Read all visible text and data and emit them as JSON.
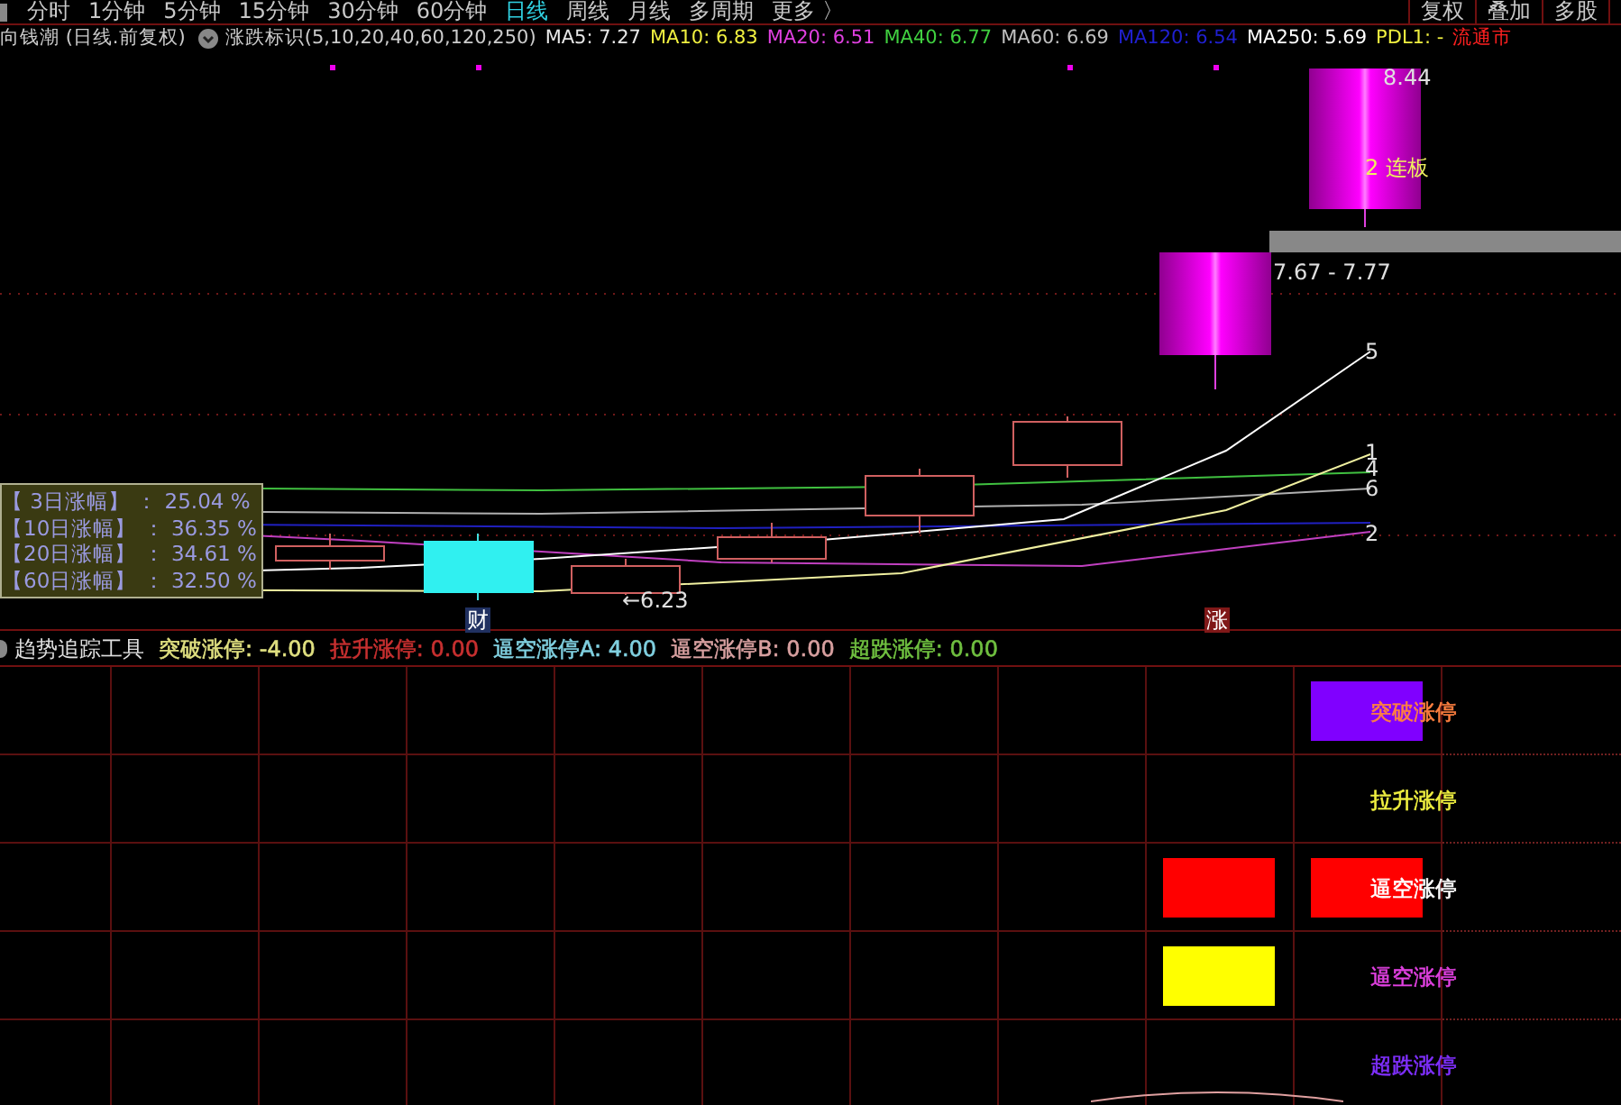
{
  "period_tabs": [
    {
      "label": "分时",
      "selected": false
    },
    {
      "label": "1分钟",
      "selected": false
    },
    {
      "label": "5分钟",
      "selected": false
    },
    {
      "label": "15分钟",
      "selected": false
    },
    {
      "label": "30分钟",
      "selected": false
    },
    {
      "label": "60分钟",
      "selected": false
    },
    {
      "label": "日线",
      "selected": true
    },
    {
      "label": "周线",
      "selected": false
    },
    {
      "label": "月线",
      "selected": false
    },
    {
      "label": "多周期",
      "selected": false
    },
    {
      "label": "更多 〉",
      "selected": false
    }
  ],
  "toolbar_buttons": [
    "复权",
    "叠加",
    "多股"
  ],
  "main_legend": {
    "title": "向钱潮 (日线.前复权)",
    "indicator": "涨跌标识(5,10,20,40,60,120,250)",
    "items": [
      {
        "text": "MA5: 7.27",
        "color": "#e8e8e8"
      },
      {
        "text": "MA10: 6.83",
        "color": "#f0f040"
      },
      {
        "text": "MA20: 6.51",
        "color": "#e040e0"
      },
      {
        "text": "MA40: 6.77",
        "color": "#40d040"
      },
      {
        "text": "MA60: 6.69",
        "color": "#c0c0c0"
      },
      {
        "text": "MA120: 6.54",
        "color": "#2020d0"
      },
      {
        "text": "MA250: 5.69",
        "color": "#ffffff"
      },
      {
        "text": "PDL1: -",
        "color": "#f0f040"
      },
      {
        "text": "流通市",
        "color": "#ff2020"
      }
    ]
  },
  "chart_labels": {
    "high_price": "8.44",
    "streak": "2 连板",
    "price_range": "7.67 - 7.77",
    "low_price": "←6.23",
    "line_labels": [
      "5",
      "1",
      "4",
      "6",
      "2"
    ],
    "finance_marker": "财",
    "limit_up_marker": "涨"
  },
  "gain_box": [
    "【  3日涨幅】 ：  25.04 %",
    "【10日涨幅】 ：  36.35 %",
    "【20日涨幅】 ：  34.61 %",
    "【60日涨幅】 ：  32.50 %"
  ],
  "indicator_legend": {
    "title": "趋势追踪工具",
    "items": [
      {
        "text": "突破涨停: -4.00",
        "color": "#e0e080"
      },
      {
        "text": "拉升涨停: 0.00",
        "color": "#c83030"
      },
      {
        "text": "逼空涨停A: 4.00",
        "color": "#80d0e0"
      },
      {
        "text": "逼空涨停B: 0.00",
        "color": "#d8a0a0"
      },
      {
        "text": "超跌涨停: 0.00",
        "color": "#70c040"
      }
    ]
  },
  "signal_rows": [
    {
      "label": "突破涨停",
      "color": "#ff8040",
      "cells": [
        {
          "filled": false
        },
        {
          "filled": false
        },
        {
          "filled": false
        },
        {
          "filled": false
        },
        {
          "filled": false
        },
        {
          "filled": false
        },
        {
          "filled": false
        },
        {
          "filled": false
        },
        {
          "filled": false
        },
        {
          "filled": true,
          "color": "#8000ff"
        }
      ]
    },
    {
      "label": "拉升涨停",
      "color": "#f0f040",
      "cells": [
        {
          "filled": false
        },
        {
          "filled": false
        },
        {
          "filled": false
        },
        {
          "filled": false
        },
        {
          "filled": false
        },
        {
          "filled": false
        },
        {
          "filled": false
        },
        {
          "filled": false
        },
        {
          "filled": false
        },
        {
          "filled": false
        }
      ]
    },
    {
      "label": "逼空涨停",
      "color": "#ffffff",
      "cells": [
        {
          "filled": false
        },
        {
          "filled": false
        },
        {
          "filled": false
        },
        {
          "filled": false
        },
        {
          "filled": false
        },
        {
          "filled": false
        },
        {
          "filled": false
        },
        {
          "filled": false
        },
        {
          "filled": true,
          "color": "#ff0000"
        },
        {
          "filled": true,
          "color": "#ff0000"
        }
      ]
    },
    {
      "label": "逼空涨停",
      "color": "#e040e0",
      "cells": [
        {
          "filled": false
        },
        {
          "filled": false
        },
        {
          "filled": false
        },
        {
          "filled": false
        },
        {
          "filled": false
        },
        {
          "filled": false
        },
        {
          "filled": false
        },
        {
          "filled": false
        },
        {
          "filled": true,
          "color": "#ffff00"
        },
        {
          "filled": false
        }
      ]
    },
    {
      "label": "超跌涨停",
      "color": "#8030ff",
      "cells": [
        {
          "filled": false
        },
        {
          "filled": false
        },
        {
          "filled": false
        },
        {
          "filled": false
        },
        {
          "filled": false
        },
        {
          "filled": false
        },
        {
          "filled": false
        },
        {
          "filled": false
        },
        {
          "filled": false
        },
        {
          "filled": false
        }
      ]
    }
  ]
}
